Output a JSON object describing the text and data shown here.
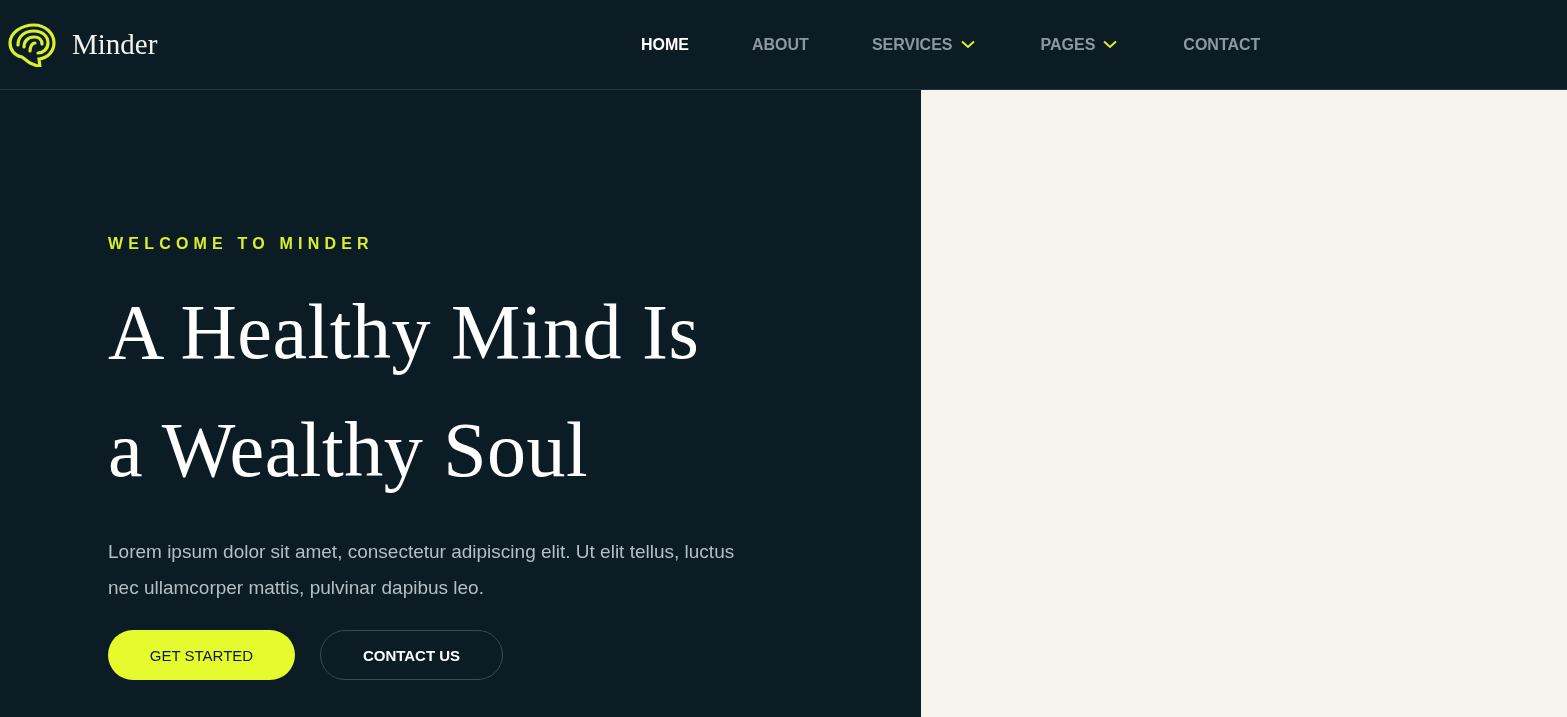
{
  "brand": {
    "name": "Minder"
  },
  "nav": [
    {
      "label": "HOME",
      "selected": true,
      "kind": "link"
    },
    {
      "label": "ABOUT",
      "selected": false,
      "kind": "link"
    },
    {
      "label": "SERVICES",
      "selected": false,
      "kind": "dropdown"
    },
    {
      "label": "PAGES",
      "selected": false,
      "kind": "dropdown"
    },
    {
      "label": "CONTACT",
      "selected": false,
      "kind": "link"
    }
  ],
  "hero": {
    "eyebrow": "WELCOME TO MINDER",
    "heading_lines": [
      "A Healthy Mind Is",
      "a Wealthy Soul"
    ],
    "text": "Lorem ipsum dolor sit amet, consectetur adipiscing elit. Ut elit tellus, luctus nec ullamcorper mattis, pulvinar dapibus leo.",
    "buttons": [
      {
        "label": "GET STARTED",
        "kind": "primary"
      },
      {
        "label": "CONTACT US",
        "kind": "outline"
      }
    ]
  }
}
